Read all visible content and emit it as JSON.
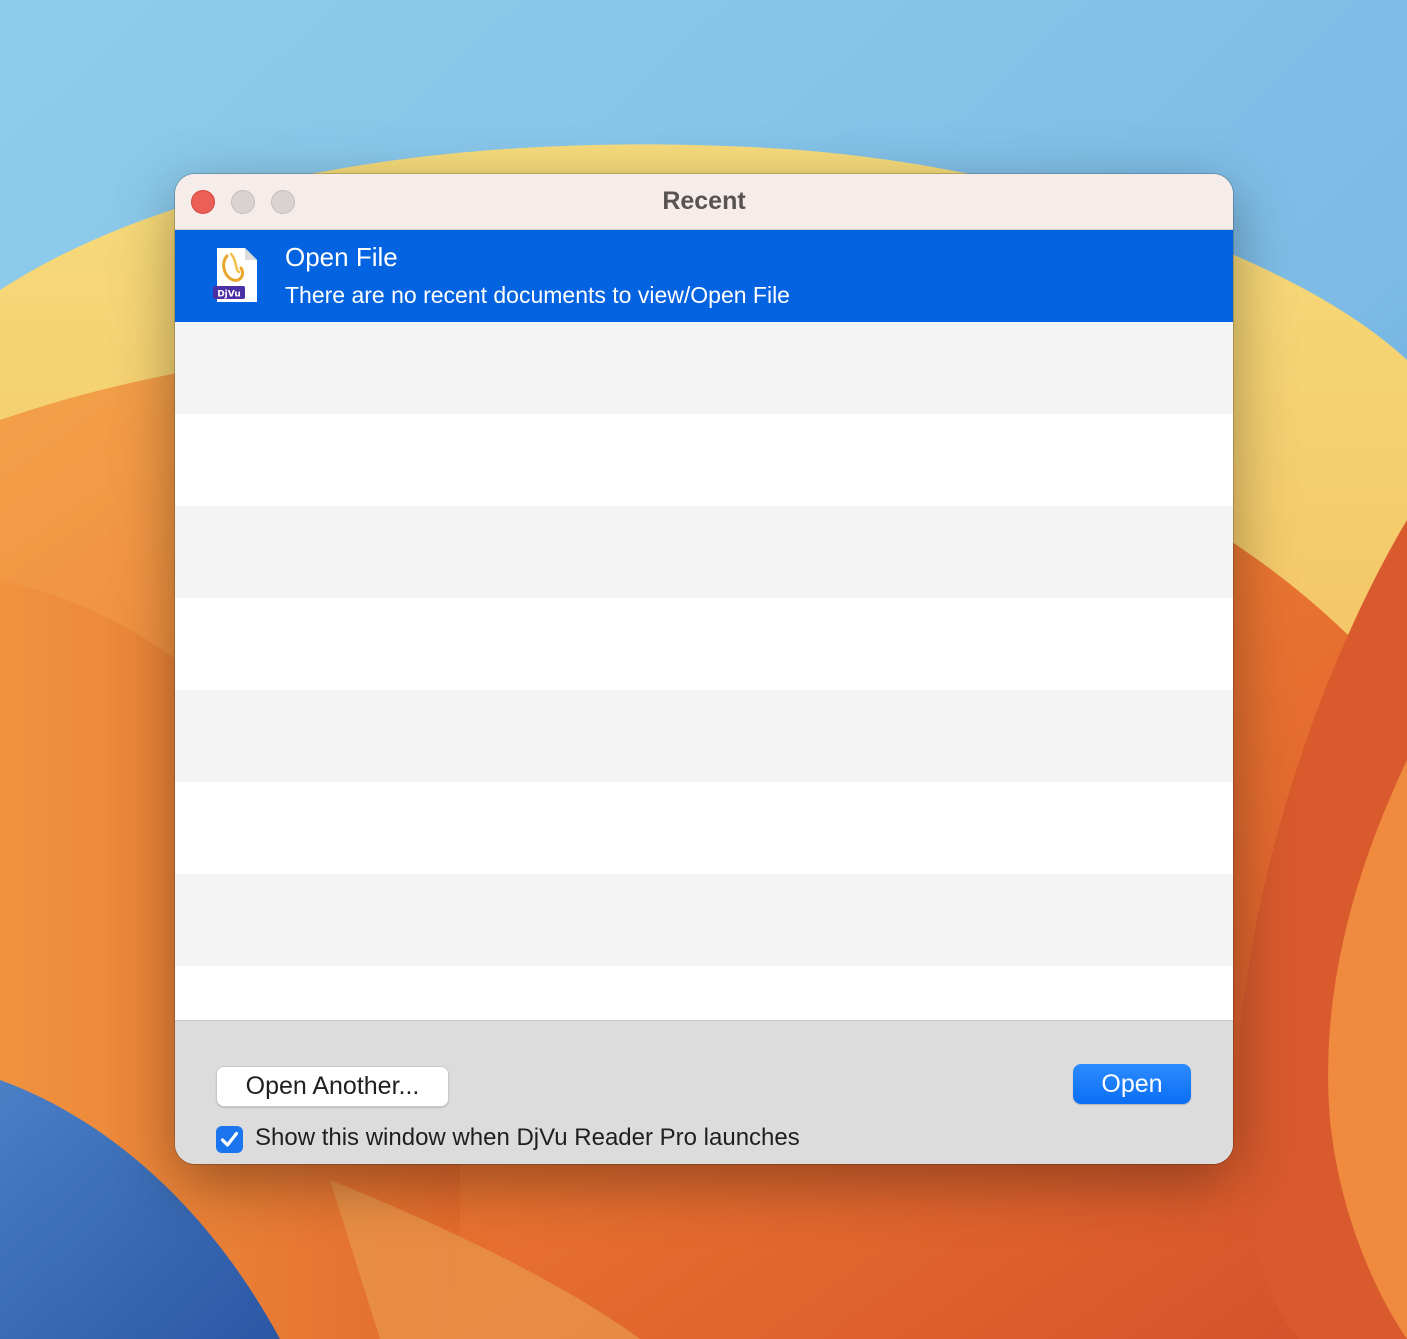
{
  "window": {
    "title": "Recent"
  },
  "recent_list": {
    "items": [
      {
        "title": "Open File",
        "subtitle": "There are no recent documents to view/Open File",
        "icon": "djvu-file-icon",
        "icon_badge": "DjVu",
        "selected": true
      }
    ]
  },
  "footer": {
    "open_another_label": "Open Another...",
    "open_label": "Open",
    "show_on_launch_label": "Show this window when DjVu Reader Pro launches",
    "show_on_launch_checked": true
  },
  "colors": {
    "selection": "#0463e1",
    "primary_button": "#0b6ff5",
    "close_button": "#ec5f57"
  }
}
